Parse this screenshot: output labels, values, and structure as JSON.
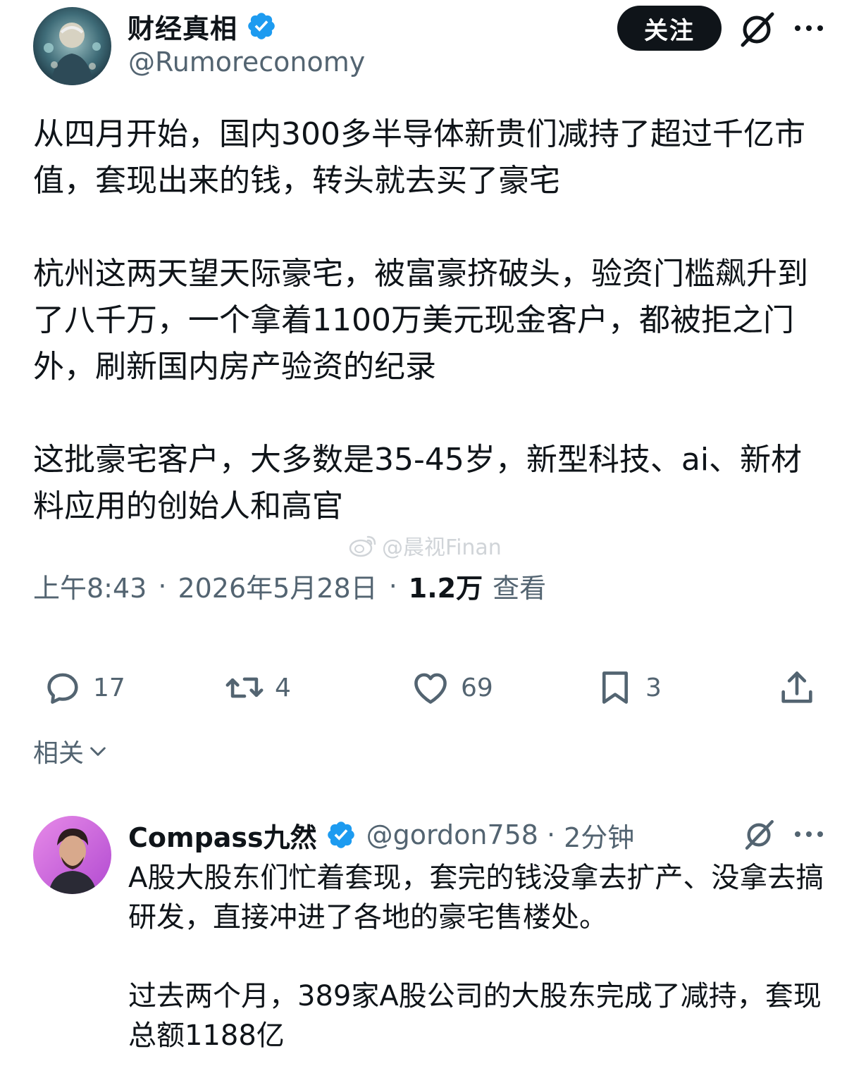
{
  "tweet": {
    "author": {
      "display_name": "财经真相",
      "handle": "@Rumoreconomy",
      "avatar_icon": "avatar-finance-illustration",
      "verified_icon": "verified-badge-icon"
    },
    "follow_label": "关注",
    "paragraphs": [
      "从四月开始，国内300多半导体新贵们减持了超过千亿市值，套现出来的钱，转头就去买了豪宅",
      "杭州这两天望天际豪宅，被富豪挤破头，验资门槛飙升到了八千万，一个拿着1100万美元现金客户，都被拒之门外，刷新国内房产验资的纪录",
      "这批豪宅客户，大多数是35-45岁，新型科技、ai、新材料应用的创始人和高官"
    ],
    "watermark": "@晨视Finan",
    "time": "上午8:43",
    "date": "2026年5月28日",
    "separator": "·",
    "views_count": "1.2万",
    "views_label": "查看"
  },
  "actions": {
    "reply_count": "17",
    "retweet_count": "4",
    "like_count": "69",
    "bookmark_count": "3"
  },
  "related_label": "相关",
  "reply": {
    "display_name": "Compass九然",
    "handle": "@gordon758",
    "separator": "·",
    "time": "2分钟",
    "paragraphs": [
      "A股大股东们忙着套现，套完的钱没拿去扩产、没拿去搞研发，直接冲进了各地的豪宅售楼处。",
      "过去两个月，389家A股公司的大股东完成了减持，套现总额1188亿"
    ]
  },
  "colors": {
    "text_primary": "#0f1419",
    "text_secondary": "#536471",
    "verified_blue": "#1d9bf0",
    "follow_bg": "#0f1419"
  }
}
